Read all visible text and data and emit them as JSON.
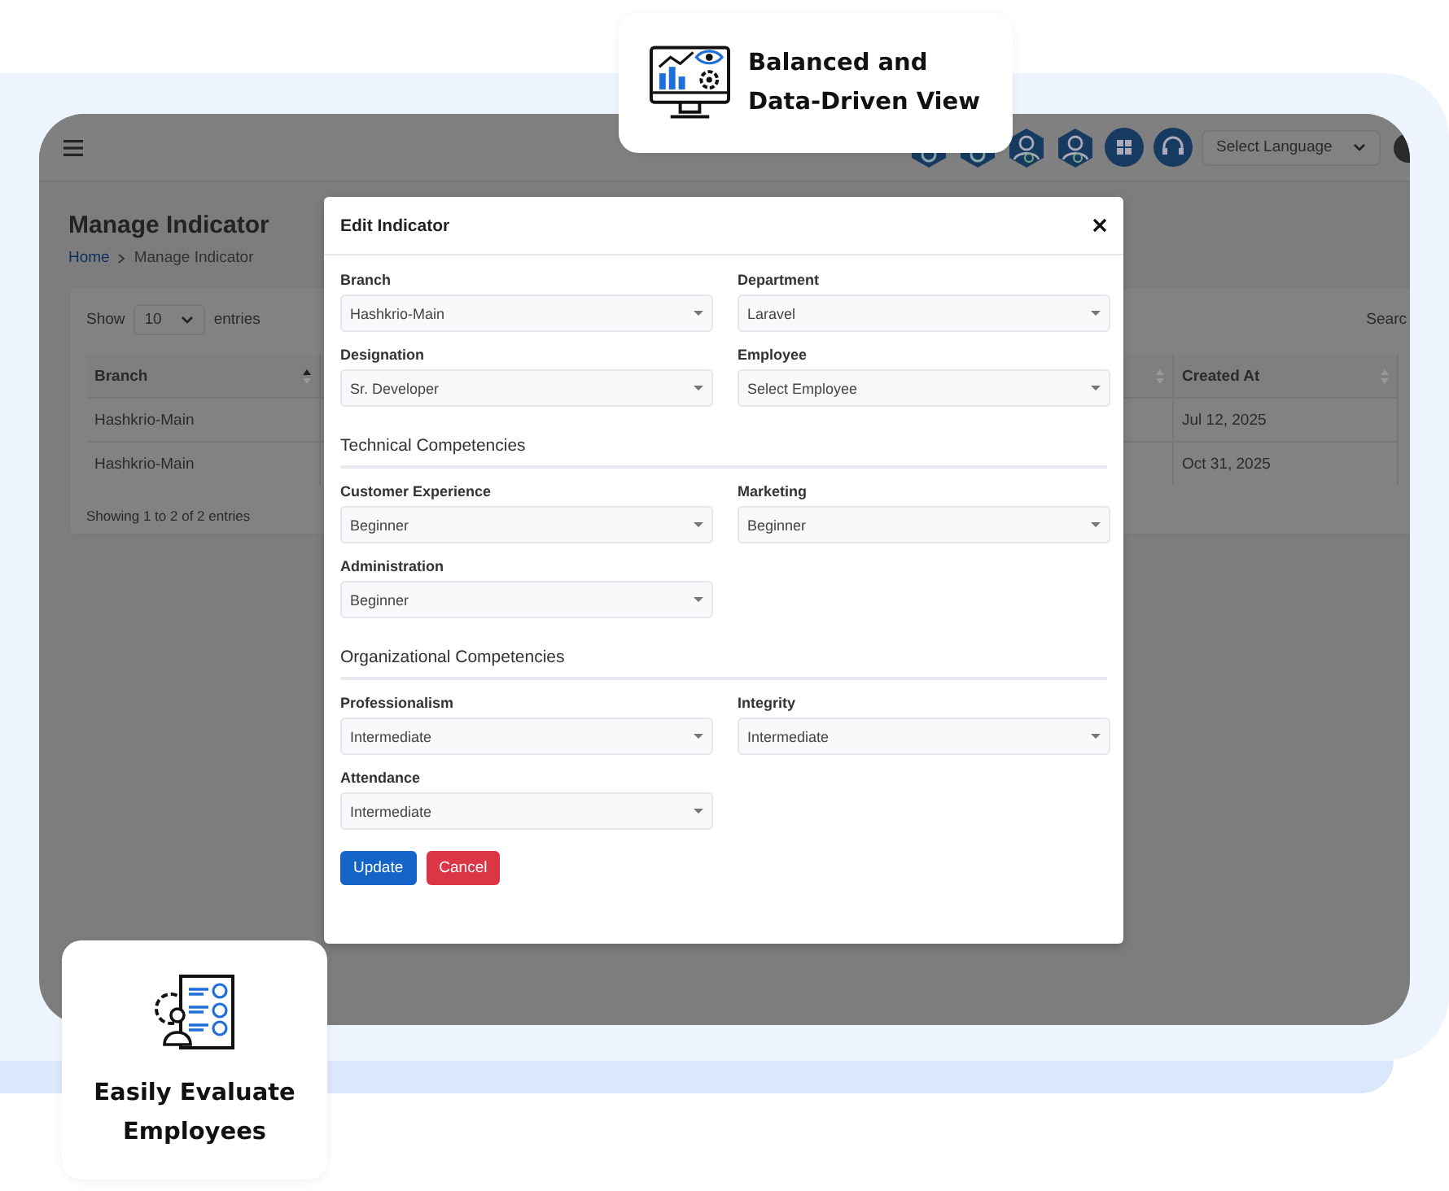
{
  "callouts": [
    {
      "kind": "monitor",
      "title": "Balanced and Data-Driven View"
    },
    {
      "kind": "checklist",
      "title": "Easily Evaluate Employees"
    }
  ],
  "app": {
    "header": {
      "language": {
        "placeholder": "Select Language"
      }
    },
    "page_title": "Manage Indicator",
    "breadcrumb": [
      "Home",
      "Manage Indicator"
    ],
    "entries": {
      "show": "Show",
      "value": "10",
      "suffix": "entries"
    },
    "search_label": "Searc",
    "table": {
      "columns": [
        {
          "label": "Branch",
          "sorted": true
        },
        {},
        {
          "sorted": false
        },
        {
          "label": "Created At",
          "sorted": false
        }
      ],
      "rows": [
        [
          "Hashkrio-Main",
          "",
          "",
          "Jul 12, 2025"
        ],
        [
          "Hashkrio-Main",
          "",
          "",
          "Oct 31, 2025"
        ]
      ]
    },
    "footer": "Showing 1 to 2 of 2 entries"
  },
  "modal": {
    "title": "Edit Indicator",
    "groups": [
      {
        "fields": [
          {
            "label": "Branch",
            "value": "Hashkrio-Main"
          },
          {
            "label": "Department",
            "value": "Laravel"
          },
          {
            "label": "Designation",
            "value": "Sr. Developer"
          },
          {
            "label": "Employee",
            "value": "Select Employee"
          }
        ]
      },
      {
        "heading": "Technical Competencies",
        "fields": [
          {
            "label": "Customer Experience",
            "value": "Beginner"
          },
          {
            "label": "Marketing",
            "value": "Beginner"
          },
          {
            "label": "Administration",
            "value": "Beginner"
          }
        ]
      },
      {
        "heading": "Organizational Competencies",
        "fields": [
          {
            "label": "Professionalism",
            "value": "Intermediate"
          },
          {
            "label": "Integrity",
            "value": "Intermediate"
          },
          {
            "label": "Attendance",
            "value": "Intermediate"
          }
        ]
      }
    ],
    "buttons": [
      {
        "kind": "primary",
        "label": "Update"
      },
      {
        "kind": "danger",
        "label": "Cancel"
      }
    ]
  }
}
